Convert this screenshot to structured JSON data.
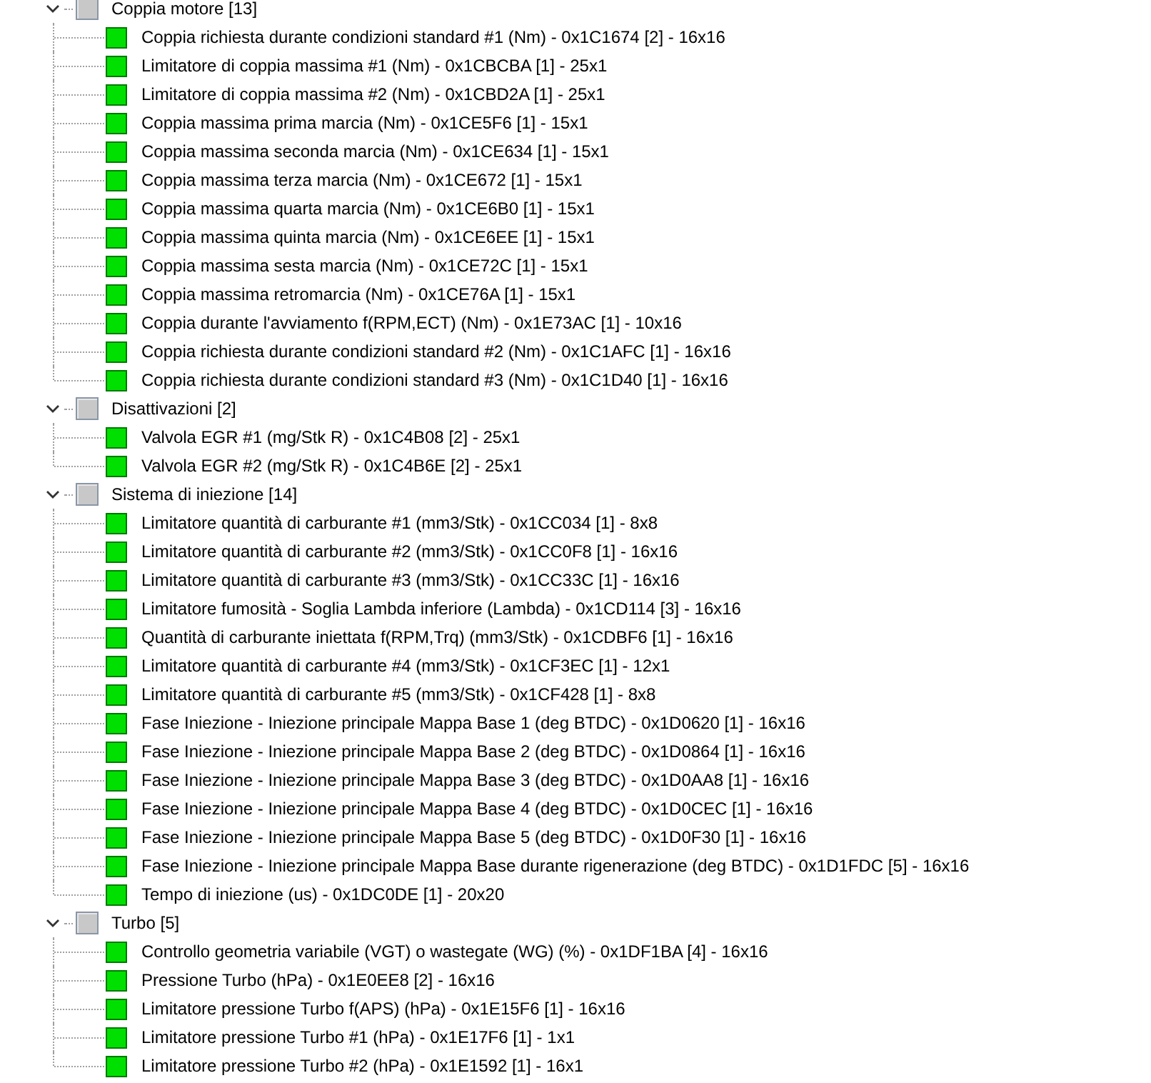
{
  "tree": [
    {
      "label": "Coppia motore [13]",
      "expanded": true,
      "children": [
        {
          "label": "Coppia richiesta durante condizioni standard #1 (Nm) - 0x1C1674 [2] - 16x16"
        },
        {
          "label": "Limitatore di coppia massima #1 (Nm) - 0x1CBCBA [1] - 25x1"
        },
        {
          "label": "Limitatore di coppia massima #2 (Nm) - 0x1CBD2A [1] - 25x1"
        },
        {
          "label": "Coppia massima prima marcia (Nm) - 0x1CE5F6 [1] - 15x1"
        },
        {
          "label": "Coppia massima seconda marcia (Nm) - 0x1CE634 [1] - 15x1"
        },
        {
          "label": "Coppia massima terza marcia (Nm) - 0x1CE672 [1] - 15x1"
        },
        {
          "label": "Coppia massima quarta marcia (Nm) - 0x1CE6B0 [1] - 15x1"
        },
        {
          "label": "Coppia massima quinta marcia (Nm) - 0x1CE6EE [1] - 15x1"
        },
        {
          "label": "Coppia massima sesta marcia (Nm) - 0x1CE72C [1] - 15x1"
        },
        {
          "label": "Coppia massima retromarcia (Nm) - 0x1CE76A [1] - 15x1"
        },
        {
          "label": "Coppia durante l'avviamento f(RPM,ECT) (Nm) - 0x1E73AC [1] - 10x16"
        },
        {
          "label": "Coppia richiesta durante condizioni standard #2 (Nm) - 0x1C1AFC [1] - 16x16"
        },
        {
          "label": "Coppia richiesta durante condizioni standard #3 (Nm) - 0x1C1D40 [1] - 16x16"
        }
      ]
    },
    {
      "label": "Disattivazioni [2]",
      "expanded": true,
      "children": [
        {
          "label": "Valvola EGR #1 (mg/Stk R) - 0x1C4B08 [2] - 25x1"
        },
        {
          "label": "Valvola EGR #2 (mg/Stk R) - 0x1C4B6E [2] - 25x1"
        }
      ]
    },
    {
      "label": "Sistema di iniezione [14]",
      "expanded": true,
      "children": [
        {
          "label": "Limitatore quantità di carburante #1 (mm3/Stk) - 0x1CC034 [1] - 8x8"
        },
        {
          "label": "Limitatore quantità di carburante #2 (mm3/Stk) - 0x1CC0F8 [1] - 16x16"
        },
        {
          "label": "Limitatore quantità di carburante #3 (mm3/Stk) - 0x1CC33C [1] - 16x16"
        },
        {
          "label": "Limitatore fumosità - Soglia Lambda inferiore (Lambda) - 0x1CD114 [3] - 16x16"
        },
        {
          "label": "Quantità di carburante iniettata f(RPM,Trq) (mm3/Stk) - 0x1CDBF6 [1] - 16x16"
        },
        {
          "label": "Limitatore quantità di carburante #4 (mm3/Stk) - 0x1CF3EC [1] - 12x1"
        },
        {
          "label": "Limitatore quantità di carburante #5 (mm3/Stk) - 0x1CF428 [1] - 8x8"
        },
        {
          "label": "Fase Iniezione - Iniezione principale Mappa Base 1 (deg BTDC) - 0x1D0620 [1] - 16x16"
        },
        {
          "label": "Fase Iniezione - Iniezione principale Mappa Base 2 (deg BTDC) - 0x1D0864 [1] - 16x16"
        },
        {
          "label": "Fase Iniezione - Iniezione principale Mappa Base 3 (deg BTDC) - 0x1D0AA8 [1] - 16x16"
        },
        {
          "label": "Fase Iniezione - Iniezione principale Mappa Base 4 (deg BTDC) - 0x1D0CEC [1] - 16x16"
        },
        {
          "label": "Fase Iniezione - Iniezione principale Mappa Base 5 (deg BTDC) - 0x1D0F30 [1] - 16x16"
        },
        {
          "label": "Fase Iniezione - Iniezione principale Mappa Base durante rigenerazione (deg BTDC) - 0x1D1FDC [5] - 16x16"
        },
        {
          "label": "Tempo di iniezione (us) - 0x1DC0DE [1] - 20x20"
        }
      ]
    },
    {
      "label": "Turbo [5]",
      "expanded": true,
      "children": [
        {
          "label": "Controllo geometria variabile (VGT) o wastegate (WG) (%) - 0x1DF1BA [4] - 16x16"
        },
        {
          "label": "Pressione Turbo (hPa) - 0x1E0EE8 [2] - 16x16"
        },
        {
          "label": "Limitatore pressione Turbo f(APS) (hPa) - 0x1E15F6 [1] - 16x16"
        },
        {
          "label": "Limitatore pressione Turbo #1 (hPa) - 0x1E17F6 [1] - 1x1"
        },
        {
          "label": "Limitatore pressione Turbo #2 (hPa) - 0x1E1592 [1] - 16x1"
        }
      ]
    }
  ]
}
